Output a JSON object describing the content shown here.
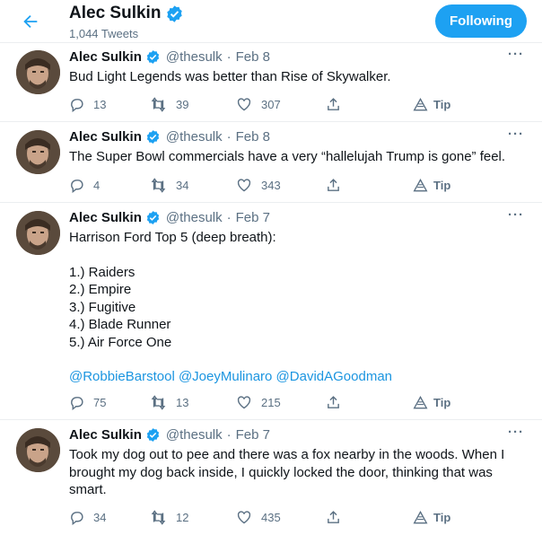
{
  "header": {
    "name": "Alec Sulkin",
    "tweet_count": "1,044 Tweets",
    "follow_label": "Following"
  },
  "colors": {
    "accent": "#1da1f2",
    "secondary_text": "#5b7083",
    "mention": "#1b95e0",
    "border": "#ebeef0"
  },
  "icons": [
    "back-arrow-icon",
    "verified-badge-icon",
    "more-icon",
    "reply-icon",
    "retweet-icon",
    "like-icon",
    "share-icon",
    "tip-icon"
  ],
  "tweets": [
    {
      "name": "Alec Sulkin",
      "handle": "@thesulk",
      "dot": "·",
      "date": "Feb 8",
      "lines": [
        "Bud Light Legends was better than Rise of Skywalker."
      ],
      "mentions": "",
      "replies": "13",
      "retweets": "39",
      "likes": "307",
      "tip": "Tip",
      "more": "···"
    },
    {
      "name": "Alec Sulkin",
      "handle": "@thesulk",
      "dot": "·",
      "date": "Feb 8",
      "lines": [
        "The Super Bowl commercials have a very “hallelujah Trump is gone” feel."
      ],
      "mentions": "",
      "replies": "4",
      "retweets": "34",
      "likes": "343",
      "tip": "Tip",
      "more": "···"
    },
    {
      "name": "Alec Sulkin",
      "handle": "@thesulk",
      "dot": "·",
      "date": "Feb 7",
      "lines": [
        "Harrison Ford Top 5 (deep breath):",
        "",
        "1.) Raiders",
        "2.) Empire",
        "3.) Fugitive",
        "4.) Blade Runner",
        "5.) Air Force One",
        ""
      ],
      "mentions": "@RobbieBarstool @JoeyMulinaro @DavidAGoodman",
      "replies": "75",
      "retweets": "13",
      "likes": "215",
      "tip": "Tip",
      "more": "···"
    },
    {
      "name": "Alec Sulkin",
      "handle": "@thesulk",
      "dot": "·",
      "date": "Feb 7",
      "lines": [
        "Took my dog out to pee and there was a fox nearby in the woods. When I",
        "brought my dog back inside, I quickly locked the door, thinking that was",
        "smart."
      ],
      "mentions": "",
      "replies": "34",
      "retweets": "12",
      "likes": "435",
      "tip": "Tip",
      "more": "···"
    }
  ]
}
